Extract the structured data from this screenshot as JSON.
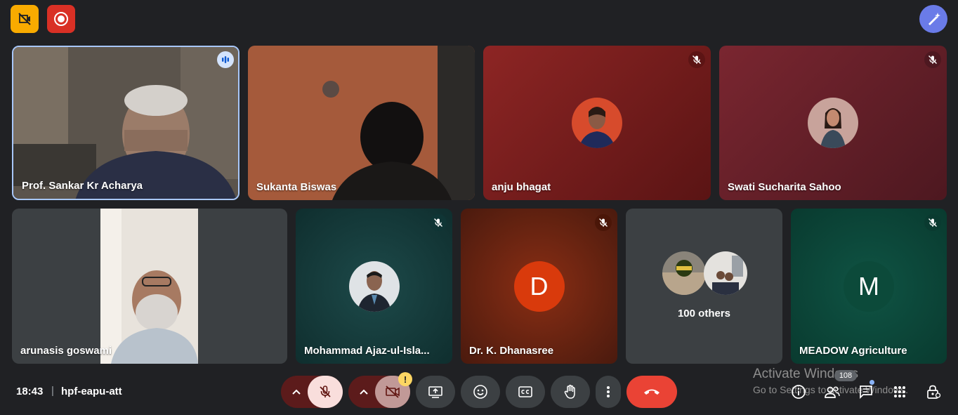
{
  "top": {
    "hide_button_icon": "video-hidden-icon",
    "record_icon": "record-icon",
    "companion_icon": "magic-pen-icon"
  },
  "tiles": [
    {
      "name": "Prof. Sankar Kr Acharya",
      "speaking": true
    },
    {
      "name": "Sukanta Biswas"
    },
    {
      "name": "anju bhagat",
      "muted": true
    },
    {
      "name": "Swati Sucharita Sahoo",
      "muted": true
    },
    {
      "name": "arunasis goswami"
    },
    {
      "name": "Mohammad Ajaz-ul-Isla...",
      "muted": true
    },
    {
      "name": "Dr. K. Dhanasree",
      "muted": true,
      "initial": "D"
    },
    {
      "name": "100 others",
      "summary": "100 others"
    },
    {
      "name": "MEADOW Agriculture",
      "muted": true,
      "initial": "M"
    }
  ],
  "footer": {
    "time": "18:43",
    "separator": "|",
    "meeting_code": "hpf-eapu-att",
    "participants_count": "108",
    "warning_badge": "!"
  },
  "watermark": {
    "line1": "Activate Windows",
    "line2": "Go to Settings to activate Windows."
  },
  "colors": {
    "background": "#202124",
    "control": "#3c4043",
    "end_call": "#ea4335",
    "muted_control": "#5c1b1b",
    "muted_control_active": "#f9dedc",
    "speaking_border": "#a8c7fa"
  }
}
